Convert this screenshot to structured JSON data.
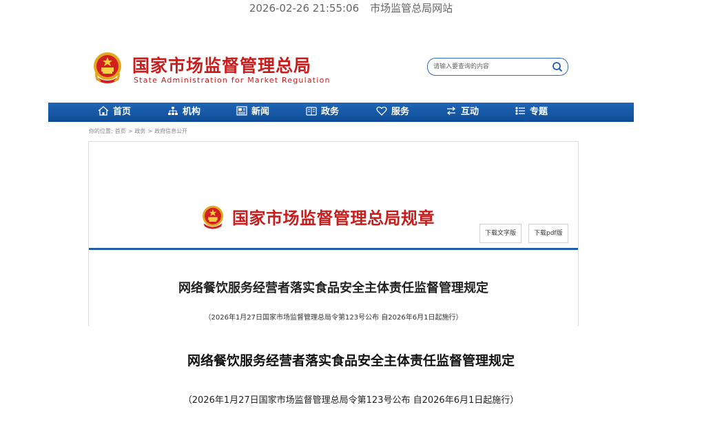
{
  "meta": {
    "timestamp": "2026-02-26 21:55:06",
    "source": "市场监管总局网站"
  },
  "header": {
    "logo_cn": "国家市场监督管理总局",
    "logo_en": "State Administration for Market Regulation",
    "search_placeholder": "请输入要查询的内容"
  },
  "nav": [
    {
      "label": "首页",
      "icon": "home-icon"
    },
    {
      "label": "机构",
      "icon": "org-chart-icon"
    },
    {
      "label": "新闻",
      "icon": "news-icon"
    },
    {
      "label": "政务",
      "icon": "affairs-icon"
    },
    {
      "label": "服务",
      "icon": "heart-icon"
    },
    {
      "label": "互动",
      "icon": "swap-arrows-icon"
    },
    {
      "label": "专题",
      "icon": "topic-icon"
    }
  ],
  "breadcrumb": {
    "prefix": "你的位置:",
    "items": [
      "首页",
      "政务",
      "政府信息公开"
    ],
    "separator": ">"
  },
  "document": {
    "header_title": "国家市场监督管理总局规章",
    "download_text": "下载文字版",
    "download_pdf": "下载pdf版",
    "title": "网络餐饮服务经营者落实食品安全主体责任监督管理规定",
    "subtitle": "（2026年1月27日国家市场监督管理总局令第123号公布 自2026年6月1日起施行）"
  },
  "main": {
    "title": "网络餐饮服务经营者落实食品安全主体责任监督管理规定",
    "subtitle": "（2026年1月27日国家市场监督管理总局令第123号公布 自2026年6月1日起施行）"
  },
  "colors": {
    "brand_red": "#c81d1d",
    "nav_blue": "#1560ad",
    "accent_blue": "#1e5ea8"
  }
}
